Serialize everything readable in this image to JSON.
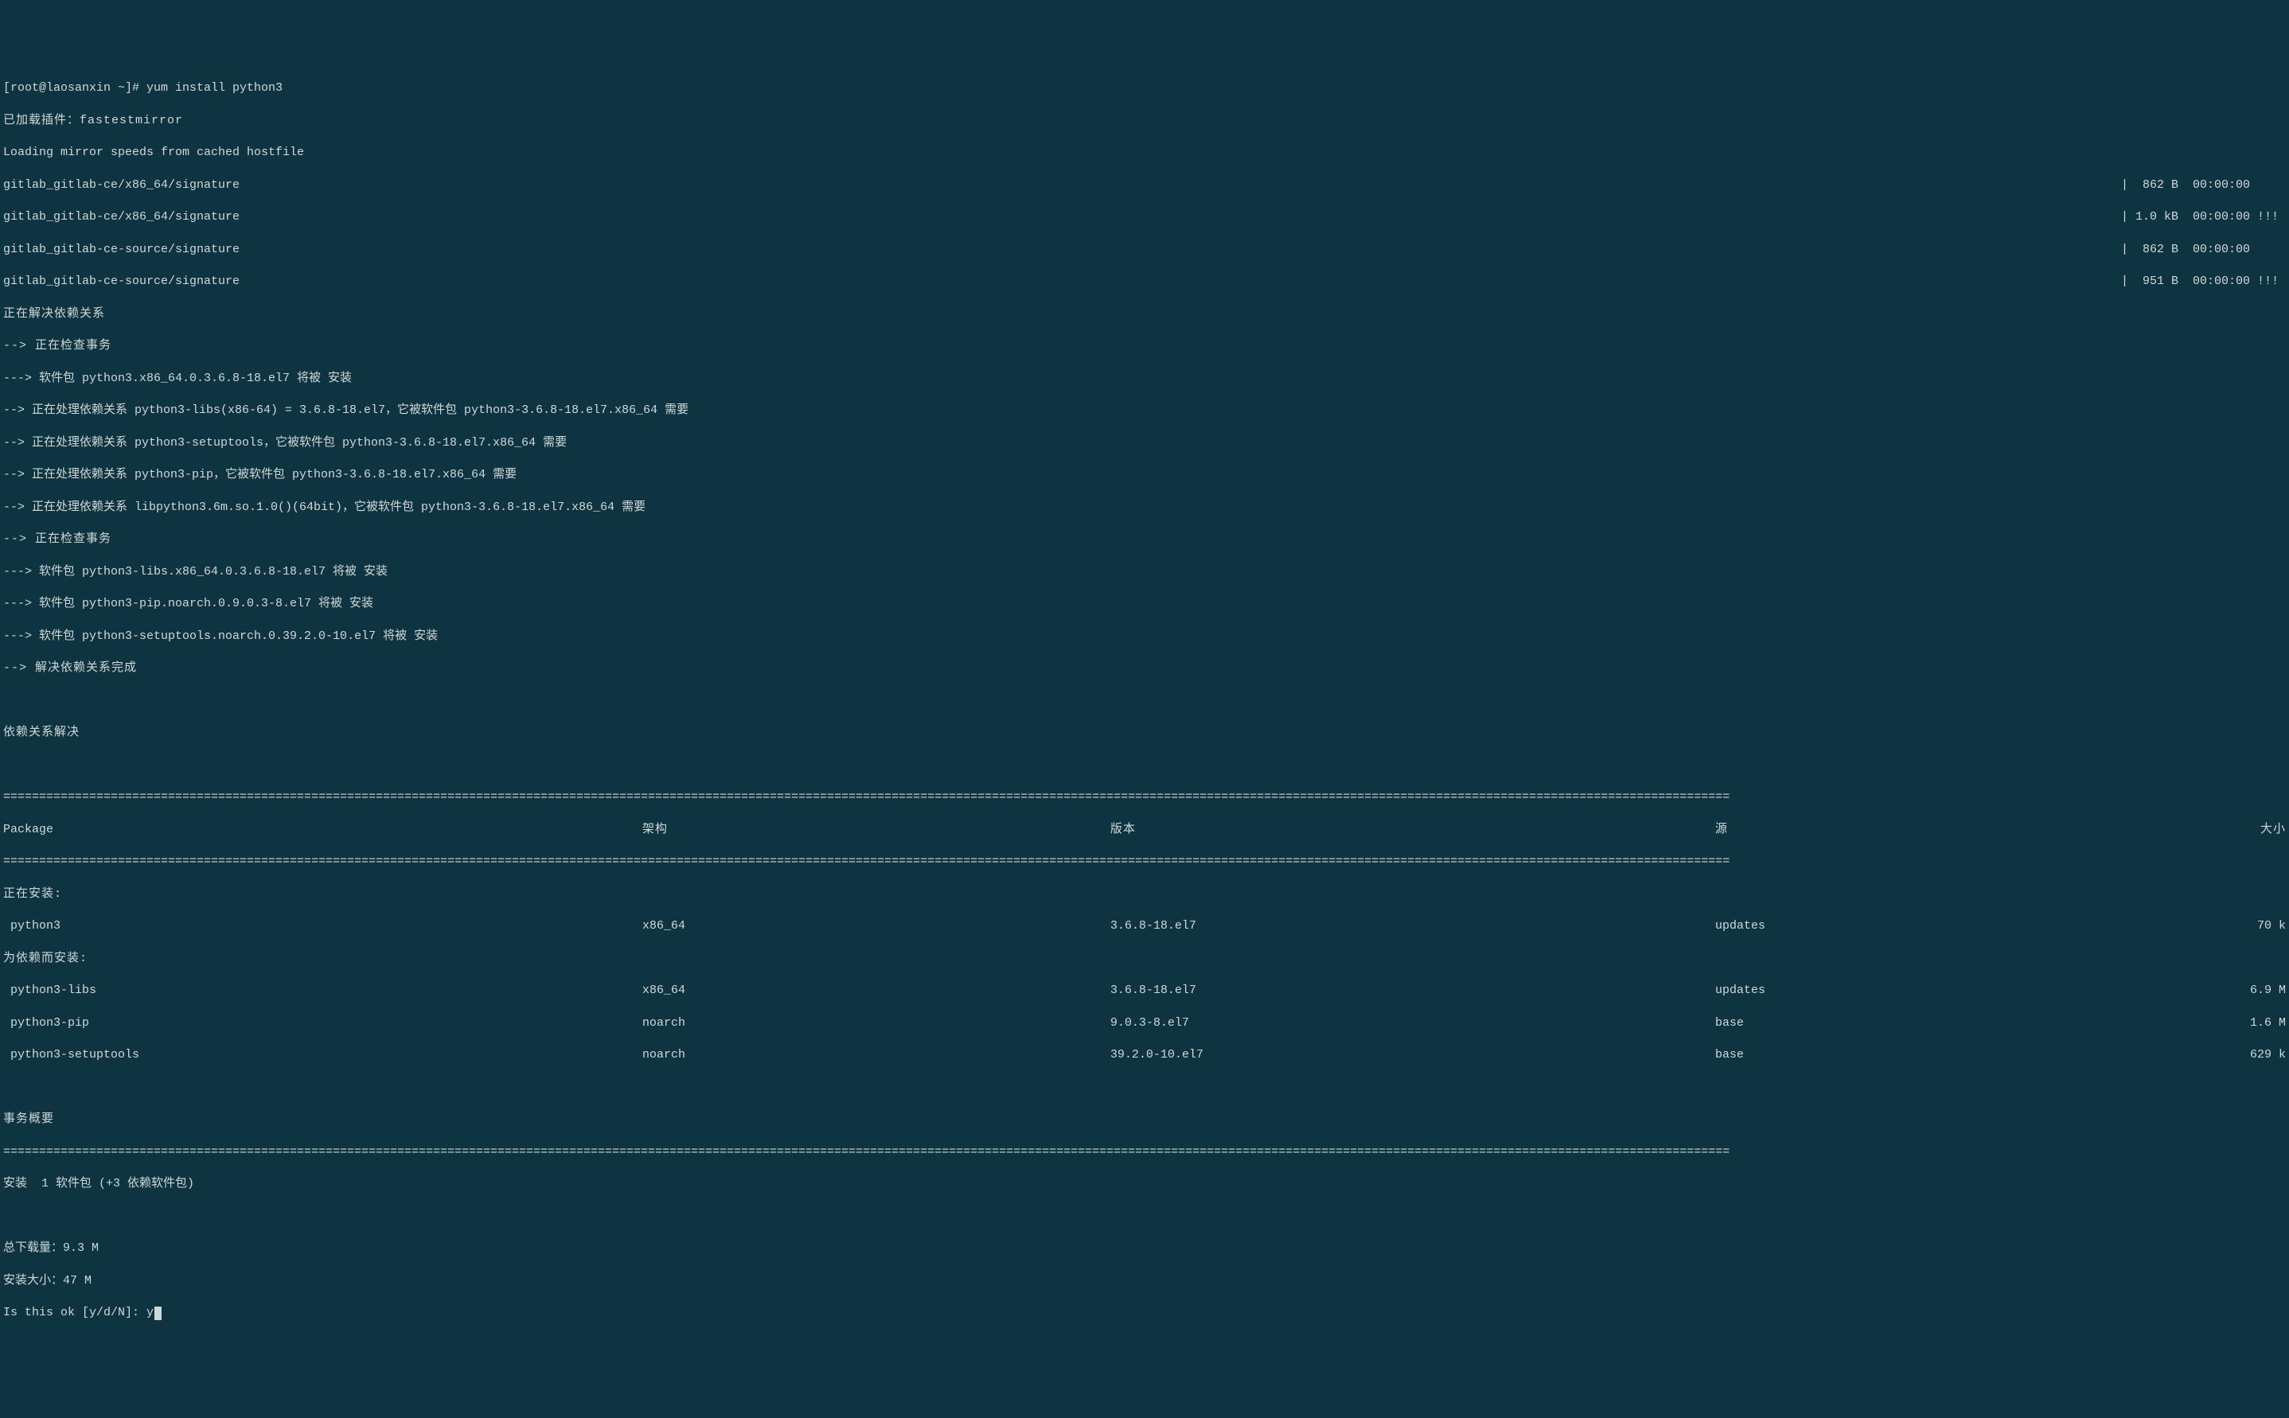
{
  "prompt": "[root@laosanxin ~]# yum install python3",
  "lines": {
    "loaded_plugins": "已加载插件：fastestmirror",
    "loading_mirror": "Loading mirror speeds from cached hostfile",
    "resolving_deps": "正在解决依赖关系",
    "checking_trans1": "--> 正在检查事务",
    "pkg_python3": "---> 软件包 python3.x86_64.0.3.6.8-18.el7 将被 安装",
    "dep1": "--> 正在处理依赖关系 python3-libs(x86-64) = 3.6.8-18.el7，它被软件包 python3-3.6.8-18.el7.x86_64 需要",
    "dep2": "--> 正在处理依赖关系 python3-setuptools，它被软件包 python3-3.6.8-18.el7.x86_64 需要",
    "dep3": "--> 正在处理依赖关系 python3-pip，它被软件包 python3-3.6.8-18.el7.x86_64 需要",
    "dep4": "--> 正在处理依赖关系 libpython3.6m.so.1.0()(64bit)，它被软件包 python3-3.6.8-18.el7.x86_64 需要",
    "checking_trans2": "--> 正在检查事务",
    "pkg_libs": "---> 软件包 python3-libs.x86_64.0.3.6.8-18.el7 将被 安装",
    "pkg_pip": "---> 软件包 python3-pip.noarch.0.9.0.3-8.el7 将被 安装",
    "pkg_setuptools": "---> 软件包 python3-setuptools.noarch.0.39.2.0-10.el7 将被 安装",
    "resolved": "--> 解决依赖关系完成",
    "deps_resolved": "依赖关系解决",
    "installing_header": "正在安装:",
    "for_deps_header": "为依赖而安装:",
    "trans_summary": "事务概要",
    "install_summary": "安装  1 软件包 (+3 依赖软件包)",
    "total_download": "总下载量：9.3 M",
    "install_size": "安装大小：47 M",
    "confirm_prompt": "Is this ok [y/d/N]: ",
    "confirm_input": "y"
  },
  "repos": [
    {
      "name": "gitlab_gitlab-ce/x86_64/signature",
      "status": "|  862 B  00:00:00     "
    },
    {
      "name": "gitlab_gitlab-ce/x86_64/signature",
      "status": "| 1.0 kB  00:00:00 !!! "
    },
    {
      "name": "gitlab_gitlab-ce-source/signature",
      "status": "|  862 B  00:00:00     "
    },
    {
      "name": "gitlab_gitlab-ce-source/signature",
      "status": "|  951 B  00:00:00 !!! "
    }
  ],
  "table": {
    "headers": {
      "package": "Package",
      "arch": "架构",
      "version": "版本",
      "repo": "源",
      "size": "大小"
    },
    "installing": [
      {
        "package": " python3",
        "arch": "x86_64",
        "version": "3.6.8-18.el7",
        "repo": "updates",
        "size": "70 k"
      }
    ],
    "deps": [
      {
        "package": " python3-libs",
        "arch": "x86_64",
        "version": "3.6.8-18.el7",
        "repo": "updates",
        "size": "6.9 M"
      },
      {
        "package": " python3-pip",
        "arch": "noarch",
        "version": "9.0.3-8.el7",
        "repo": "base",
        "size": "1.6 M"
      },
      {
        "package": " python3-setuptools",
        "arch": "noarch",
        "version": "39.2.0-10.el7",
        "repo": "base",
        "size": "629 k"
      }
    ]
  },
  "divider": "================================================================================================================================================================================================================================================="
}
